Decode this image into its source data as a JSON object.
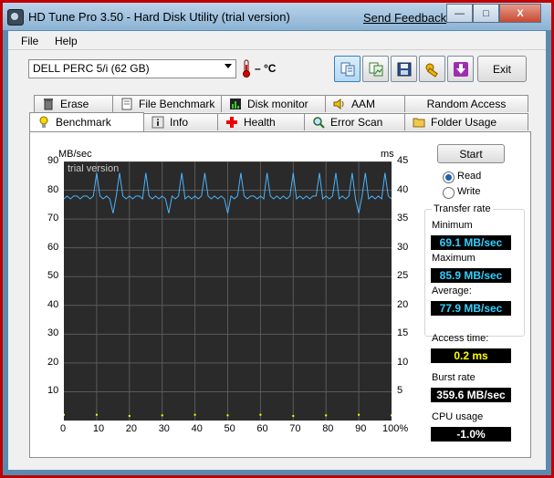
{
  "window": {
    "title": "HD Tune Pro 3.50 - Hard Disk Utility (trial version)",
    "send_feedback": "Send Feedback",
    "minimize": "—",
    "maximize": "□",
    "close": "X"
  },
  "menu": {
    "file": "File",
    "help": "Help"
  },
  "toolbar": {
    "drive": "DELL    PERC 5/i (62 GB)",
    "temperature": "– °C",
    "exit": "Exit"
  },
  "tabs_top": [
    "Erase",
    "File Benchmark",
    "Disk monitor",
    "AAM",
    "Random Access"
  ],
  "tabs_bottom": [
    "Benchmark",
    "Info",
    "Health",
    "Error Scan",
    "Folder Usage"
  ],
  "graph": {
    "left_unit": "MB/sec",
    "right_unit": "ms",
    "watermark": "trial version",
    "left_ticks": [
      "90",
      "80",
      "70",
      "60",
      "50",
      "40",
      "30",
      "20",
      "10"
    ],
    "right_ticks": [
      "45",
      "40",
      "35",
      "30",
      "25",
      "20",
      "15",
      "10",
      "5"
    ],
    "x_ticks": [
      "0",
      "10",
      "20",
      "30",
      "40",
      "50",
      "60",
      "70",
      "80",
      "90",
      "100%"
    ]
  },
  "chart_data": {
    "type": "line",
    "xlabel": "",
    "ylabel": "MB/sec",
    "y2label": "ms",
    "xlim": [
      0,
      100
    ],
    "ylim": [
      0,
      90
    ],
    "y2lim": [
      0,
      45
    ],
    "series": [
      {
        "color": "#4ab4ff",
        "x": [
          0,
          1,
          2,
          3,
          4,
          5,
          6,
          7,
          8,
          9,
          10,
          11,
          12,
          13,
          14,
          15,
          16,
          17,
          18,
          19,
          20,
          21,
          22,
          23,
          24,
          25,
          26,
          27,
          28,
          29,
          30,
          31,
          32,
          33,
          34,
          35,
          36,
          37,
          38,
          39,
          40,
          41,
          42,
          43,
          44,
          45,
          46,
          47,
          48,
          49,
          50,
          51,
          52,
          53,
          54,
          55,
          56,
          57,
          58,
          59,
          60,
          61,
          62,
          63,
          64,
          65,
          66,
          67,
          68,
          69,
          70,
          71,
          72,
          73,
          74,
          75,
          76,
          77,
          78,
          79,
          80,
          81,
          82,
          83,
          84,
          85,
          86,
          87,
          88,
          89,
          90,
          91,
          92,
          93,
          94,
          95,
          96,
          97,
          98,
          99,
          100
        ],
        "values": [
          77,
          78,
          77,
          78,
          78,
          77,
          78,
          78,
          77,
          78,
          86,
          78,
          77,
          78,
          77,
          72,
          78,
          86,
          78,
          77,
          78,
          77,
          78,
          78,
          77,
          86,
          78,
          77,
          78,
          77,
          78,
          77,
          72,
          78,
          77,
          78,
          86,
          77,
          78,
          77,
          78,
          77,
          78,
          86,
          78,
          77,
          78,
          77,
          78,
          77,
          72,
          78,
          77,
          78,
          86,
          78,
          77,
          78,
          78,
          77,
          78,
          77,
          86,
          78,
          77,
          78,
          77,
          78,
          77,
          78,
          86,
          77,
          78,
          77,
          78,
          77,
          78,
          78,
          86,
          77,
          78,
          77,
          78,
          86,
          77,
          78,
          77,
          78,
          86,
          77,
          72,
          78,
          86,
          77,
          78,
          77,
          78,
          77,
          86,
          78,
          77
        ]
      },
      {
        "color": "#ffff00",
        "x": [
          0,
          10,
          20,
          30,
          40,
          50,
          60,
          70,
          80,
          90,
          100
        ],
        "values": [
          1.0,
          1.0,
          0.8,
          0.9,
          1.0,
          0.9,
          1.0,
          0.8,
          0.9,
          1.0,
          0.9
        ]
      }
    ]
  },
  "controls": {
    "start": "Start",
    "read": "Read",
    "write": "Write",
    "transfer_rate": "Transfer rate",
    "minimum_label": "Minimum",
    "minimum_value": "69.1 MB/sec",
    "maximum_label": "Maximum",
    "maximum_value": "85.9 MB/sec",
    "average_label": "Average:",
    "average_value": "77.9 MB/sec",
    "access_label": "Access time:",
    "access_value": "0.2 ms",
    "burst_label": "Burst rate",
    "burst_value": "359.6 MB/sec",
    "cpu_label": "CPU usage",
    "cpu_value": "-1.0%"
  },
  "colors": {
    "graph_bg": "#2a2a2a",
    "grid": "#5a5a5a",
    "transfer_line": "#4ab4ff",
    "access_points": "#ffff00",
    "transfer_values": "#30d0ff",
    "access_value": "#ffff00",
    "burst_value": "#ffffff"
  }
}
